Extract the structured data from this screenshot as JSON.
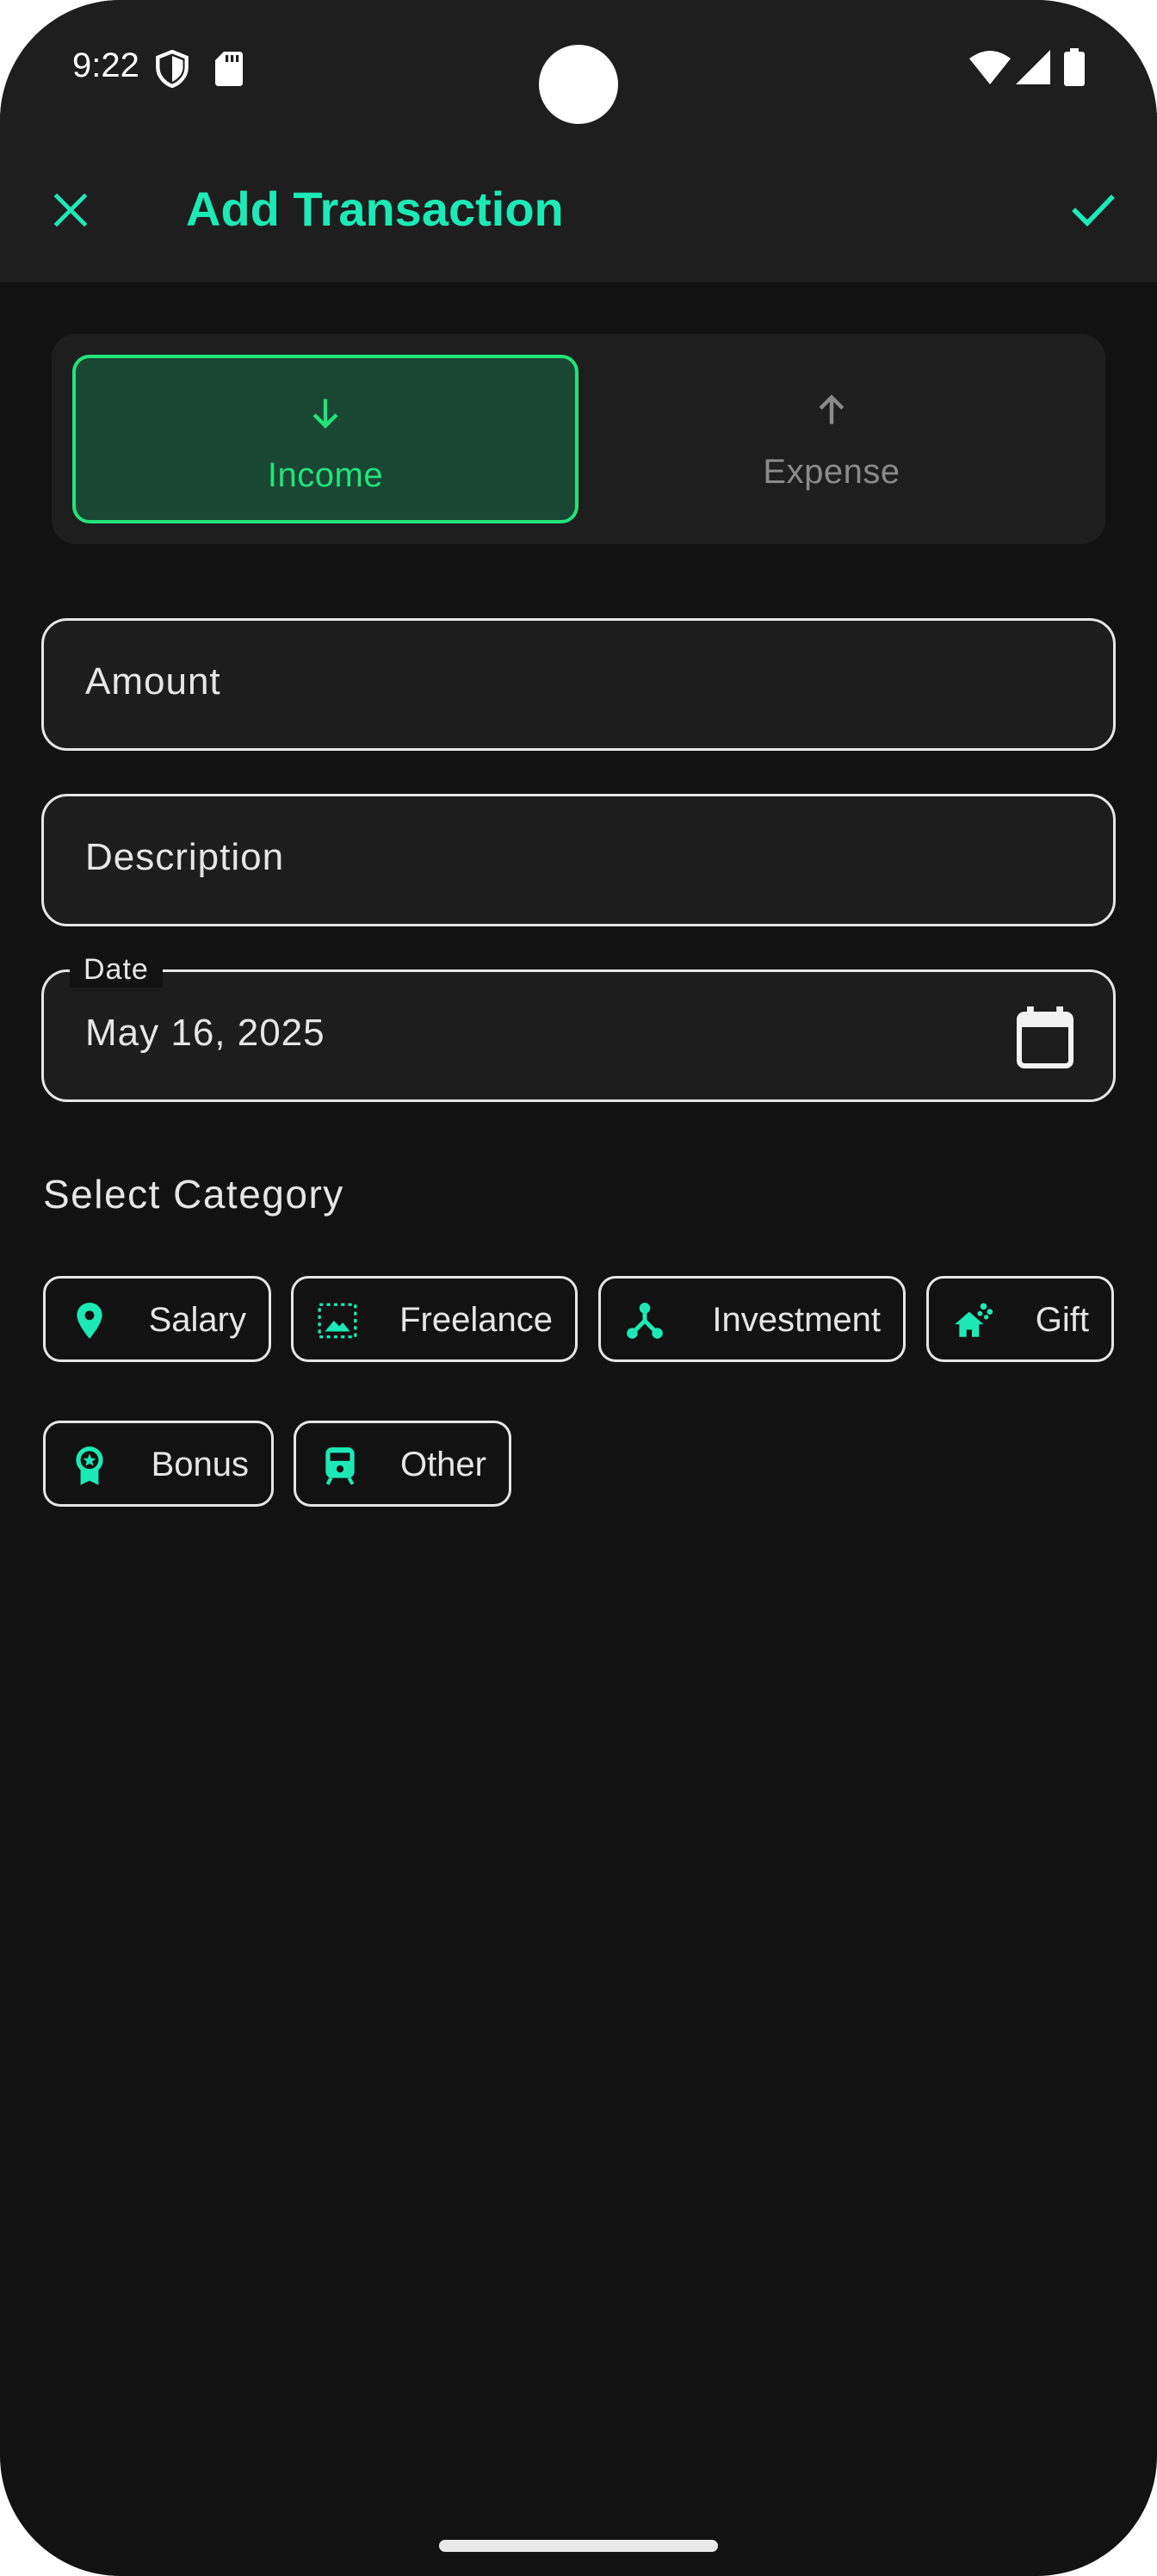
{
  "status_bar": {
    "time": "9:22",
    "icons": [
      "shield-icon",
      "sd-card-icon",
      "wifi-icon",
      "signal-icon",
      "battery-icon"
    ]
  },
  "app_bar": {
    "title": "Add Transaction",
    "close_icon": "close-icon",
    "confirm_icon": "check-icon"
  },
  "type_toggle": {
    "selected": "Income",
    "options": [
      {
        "label": "Income",
        "icon": "arrow-down-icon",
        "selected": true
      },
      {
        "label": "Expense",
        "icon": "arrow-up-icon",
        "selected": false
      }
    ]
  },
  "form": {
    "amount": {
      "placeholder": "Amount",
      "value": ""
    },
    "description": {
      "placeholder": "Description",
      "value": ""
    },
    "date": {
      "label": "Date",
      "value": "May 16, 2025",
      "icon": "calendar-icon"
    }
  },
  "category": {
    "title": "Select Category",
    "chips": [
      {
        "label": "Salary",
        "icon": "location-pin-icon"
      },
      {
        "label": "Freelance",
        "icon": "photo-frame-icon"
      },
      {
        "label": "Investment",
        "icon": "hub-icon"
      },
      {
        "label": "Gift",
        "icon": "house-sparkle-icon"
      },
      {
        "label": "Bonus",
        "icon": "award-badge-icon"
      },
      {
        "label": "Other",
        "icon": "train-icon"
      }
    ]
  },
  "colors": {
    "accent": "#1de9b6",
    "income_green": "#22e37a",
    "income_bg": "#1a4733",
    "background": "#121212",
    "surface": "#1e1e1e",
    "text": "#e6e6e6",
    "muted": "#8a8a8a"
  }
}
